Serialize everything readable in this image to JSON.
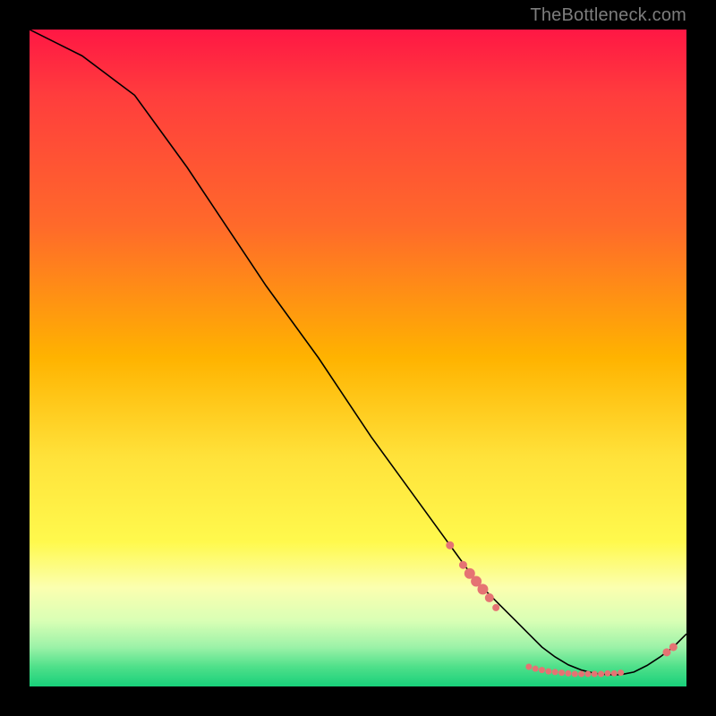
{
  "watermark": "TheBottleneck.com",
  "chart_data": {
    "type": "line",
    "title": "",
    "xlabel": "",
    "ylabel": "",
    "xlim": [
      0,
      100
    ],
    "ylim": [
      0,
      100
    ],
    "grid": false,
    "legend": false,
    "series": [
      {
        "name": "curve",
        "x": [
          0,
          4,
          8,
          12,
          16,
          20,
          24,
          28,
          32,
          36,
          40,
          44,
          48,
          52,
          56,
          60,
          64,
          68,
          72,
          74,
          76,
          78,
          80,
          82,
          84,
          86,
          88,
          90,
          92,
          94,
          96,
          98,
          100
        ],
        "y": [
          100,
          98,
          96,
          93,
          90,
          84.5,
          79,
          73,
          67,
          61,
          55.5,
          50,
          44,
          38,
          32.5,
          27,
          21.5,
          16,
          12,
          10,
          8,
          6,
          4.5,
          3.3,
          2.5,
          2.0,
          1.8,
          1.8,
          2.2,
          3.2,
          4.5,
          6.0,
          8.0
        ]
      }
    ],
    "dots": {
      "name": "markers",
      "color": "#e57373",
      "points": [
        {
          "x": 64,
          "y": 21.5,
          "r": 4.5
        },
        {
          "x": 66,
          "y": 18.5,
          "r": 4.5
        },
        {
          "x": 67,
          "y": 17.2,
          "r": 6.0
        },
        {
          "x": 68,
          "y": 16.0,
          "r": 6.0
        },
        {
          "x": 69,
          "y": 14.8,
          "r": 6.0
        },
        {
          "x": 70,
          "y": 13.5,
          "r": 5.0
        },
        {
          "x": 71,
          "y": 12.0,
          "r": 4.0
        },
        {
          "x": 76,
          "y": 3.0,
          "r": 3.5
        },
        {
          "x": 77,
          "y": 2.7,
          "r": 3.5
        },
        {
          "x": 78,
          "y": 2.5,
          "r": 3.5
        },
        {
          "x": 79,
          "y": 2.3,
          "r": 3.5
        },
        {
          "x": 80,
          "y": 2.2,
          "r": 3.5
        },
        {
          "x": 81,
          "y": 2.1,
          "r": 3.5
        },
        {
          "x": 82,
          "y": 2.0,
          "r": 3.5
        },
        {
          "x": 83,
          "y": 1.9,
          "r": 3.5
        },
        {
          "x": 84,
          "y": 1.9,
          "r": 3.5
        },
        {
          "x": 85,
          "y": 1.9,
          "r": 3.5
        },
        {
          "x": 86,
          "y": 1.9,
          "r": 3.5
        },
        {
          "x": 87,
          "y": 1.9,
          "r": 3.5
        },
        {
          "x": 88,
          "y": 2.0,
          "r": 3.5
        },
        {
          "x": 89,
          "y": 2.0,
          "r": 3.5
        },
        {
          "x": 90,
          "y": 2.1,
          "r": 3.5
        },
        {
          "x": 97,
          "y": 5.2,
          "r": 4.5
        },
        {
          "x": 98,
          "y": 6.0,
          "r": 4.5
        }
      ]
    }
  }
}
